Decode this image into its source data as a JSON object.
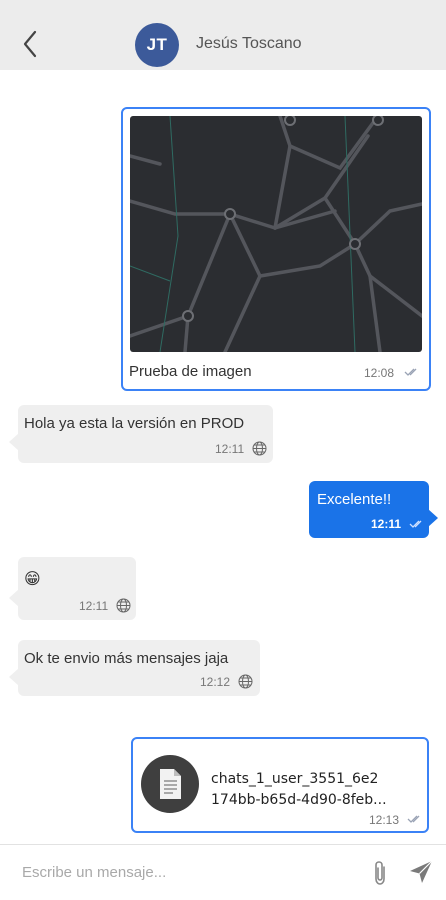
{
  "header": {
    "back_icon": "chevron-left-icon",
    "avatar_initials": "JT",
    "avatar_color": "#3c5a9a",
    "contact_name": "Jesús Toscano"
  },
  "messages": [
    {
      "type": "image",
      "direction": "outgoing",
      "caption": "Prueba de imagen",
      "time": "12:08",
      "status_icon": "double-check-icon"
    },
    {
      "type": "text",
      "direction": "incoming",
      "text": "Hola ya esta la versión en PROD",
      "time": "12:11",
      "status_icon": "globe-icon"
    },
    {
      "type": "text",
      "direction": "outgoing",
      "text": "Excelente!!",
      "time": "12:11",
      "status_icon": "double-check-icon"
    },
    {
      "type": "emoji",
      "direction": "incoming",
      "text": "😁",
      "time": "12:11",
      "status_icon": "globe-icon"
    },
    {
      "type": "text",
      "direction": "incoming",
      "text": "Ok te envio más mensajes jaja",
      "time": "12:12",
      "status_icon": "globe-icon"
    },
    {
      "type": "file",
      "direction": "outgoing",
      "file_line1": "chats_1_user_3551_6e2",
      "file_line2": "174bb-b65d-4d90-8feb...",
      "time": "12:13",
      "status_icon": "double-check-icon"
    }
  ],
  "composer": {
    "placeholder": "Escribe un mensaje...",
    "attach_icon": "paperclip-icon",
    "send_icon": "send-icon"
  },
  "colors": {
    "accent": "#1a73e8",
    "outgoing_border": "#3b82f6",
    "incoming_bg": "#efefef",
    "header_bg": "#ececec"
  }
}
